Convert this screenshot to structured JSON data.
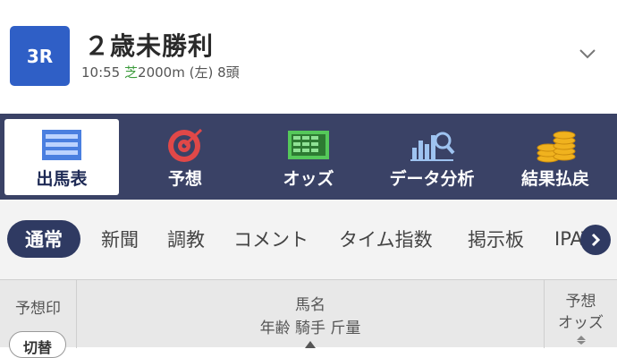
{
  "race": {
    "number": "3R",
    "title": "２歳未勝利",
    "time": "10:55",
    "surface": "芝",
    "distance": "2000m",
    "direction": "(左)",
    "runners": "8頭"
  },
  "main_nav": [
    {
      "label": "出馬表",
      "icon": "list-icon",
      "active": true
    },
    {
      "label": "予想",
      "icon": "target-icon",
      "active": false
    },
    {
      "label": "オッズ",
      "icon": "odds-board-icon",
      "active": false
    },
    {
      "label": "データ分析",
      "icon": "chart-analysis-icon",
      "active": false
    },
    {
      "label": "結果払戻",
      "icon": "coins-icon",
      "active": false
    }
  ],
  "sub_tabs": [
    {
      "label": "通常",
      "active": true
    },
    {
      "label": "新聞",
      "active": false
    },
    {
      "label": "調教",
      "active": false
    },
    {
      "label": "コメント",
      "active": false
    },
    {
      "label": "タイム指数",
      "active": false
    },
    {
      "label": "掲示板",
      "active": false
    },
    {
      "label": "IPAT",
      "active": false
    }
  ],
  "table_header": {
    "mark_label": "予想印",
    "toggle_label": "切替",
    "horse_label": "馬名",
    "horse_sub_label": "年齢 騎手 斤量",
    "odds_label_1": "予想",
    "odds_label_2": "オッズ"
  },
  "colors": {
    "badge": "#2f5fc6",
    "nav_bg": "#3a4266",
    "tab_active": "#2f3a62",
    "surface_turf": "#3b9b3b"
  }
}
